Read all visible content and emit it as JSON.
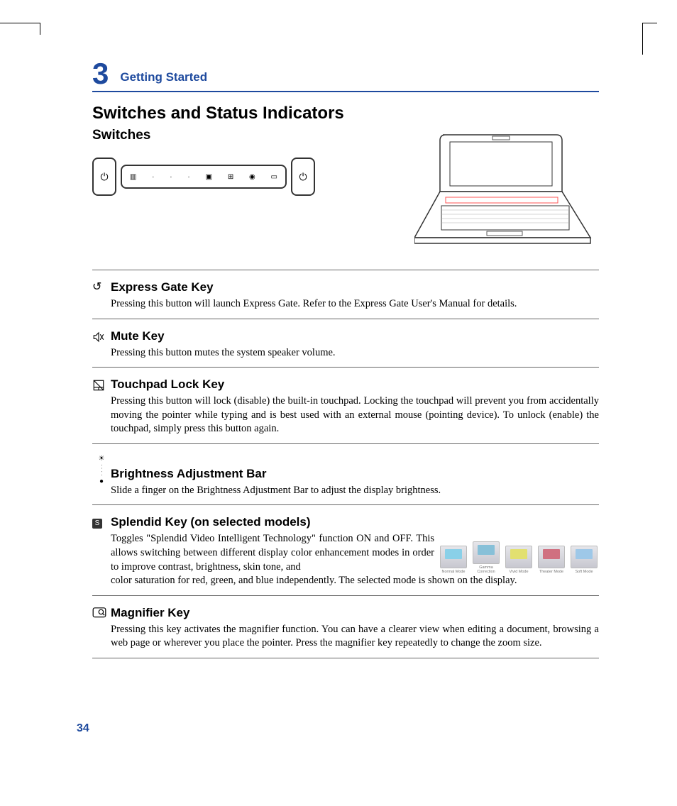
{
  "chapter": {
    "number": "3",
    "title": "Getting Started"
  },
  "page_title": "Switches and Status Indicators",
  "subtitle": "Switches",
  "sections": {
    "express_gate": {
      "title": "Express Gate Key",
      "body": "Pressing this button will launch Express Gate. Refer to the Express Gate User's Manual for details."
    },
    "mute": {
      "title": "Mute Key",
      "body": "Pressing this button mutes the system speaker volume."
    },
    "touchpad": {
      "title": "Touchpad Lock Key",
      "body": "Pressing this button will lock (disable) the built-in touchpad. Locking the touchpad will prevent you from accidentally moving the pointer while typing and is best used with an external mouse (pointing device). To unlock (enable) the touchpad, simply press this button again."
    },
    "brightness": {
      "title": "Brightness Adjustment Bar",
      "body": "Slide a finger on the Brightness Adjustment Bar to adjust the display brightness."
    },
    "splendid": {
      "title": "Splendid Key (on selected models)",
      "body_a": "Toggles \"Splendid Video Intelligent Technology\" function ON and OFF. This allows switching between different display color enhancement modes in order to improve contrast, brightness, skin tone, and",
      "body_b": "color saturation for red, green, and blue independently. The selected mode is shown on the display.",
      "modes": [
        "Normal Mode",
        "Gamma Correction",
        "Vivid Mode",
        "Theater Mode",
        "Soft Mode"
      ]
    },
    "magnifier": {
      "title": "Magnifier Key",
      "body": "Pressing this key activates the magnifier function. You can have a clearer view when editing a document, browsing a web page or wherever you place the pointer. Press the magnifier key repeatedly to change the zoom size."
    }
  },
  "page_number": "34"
}
